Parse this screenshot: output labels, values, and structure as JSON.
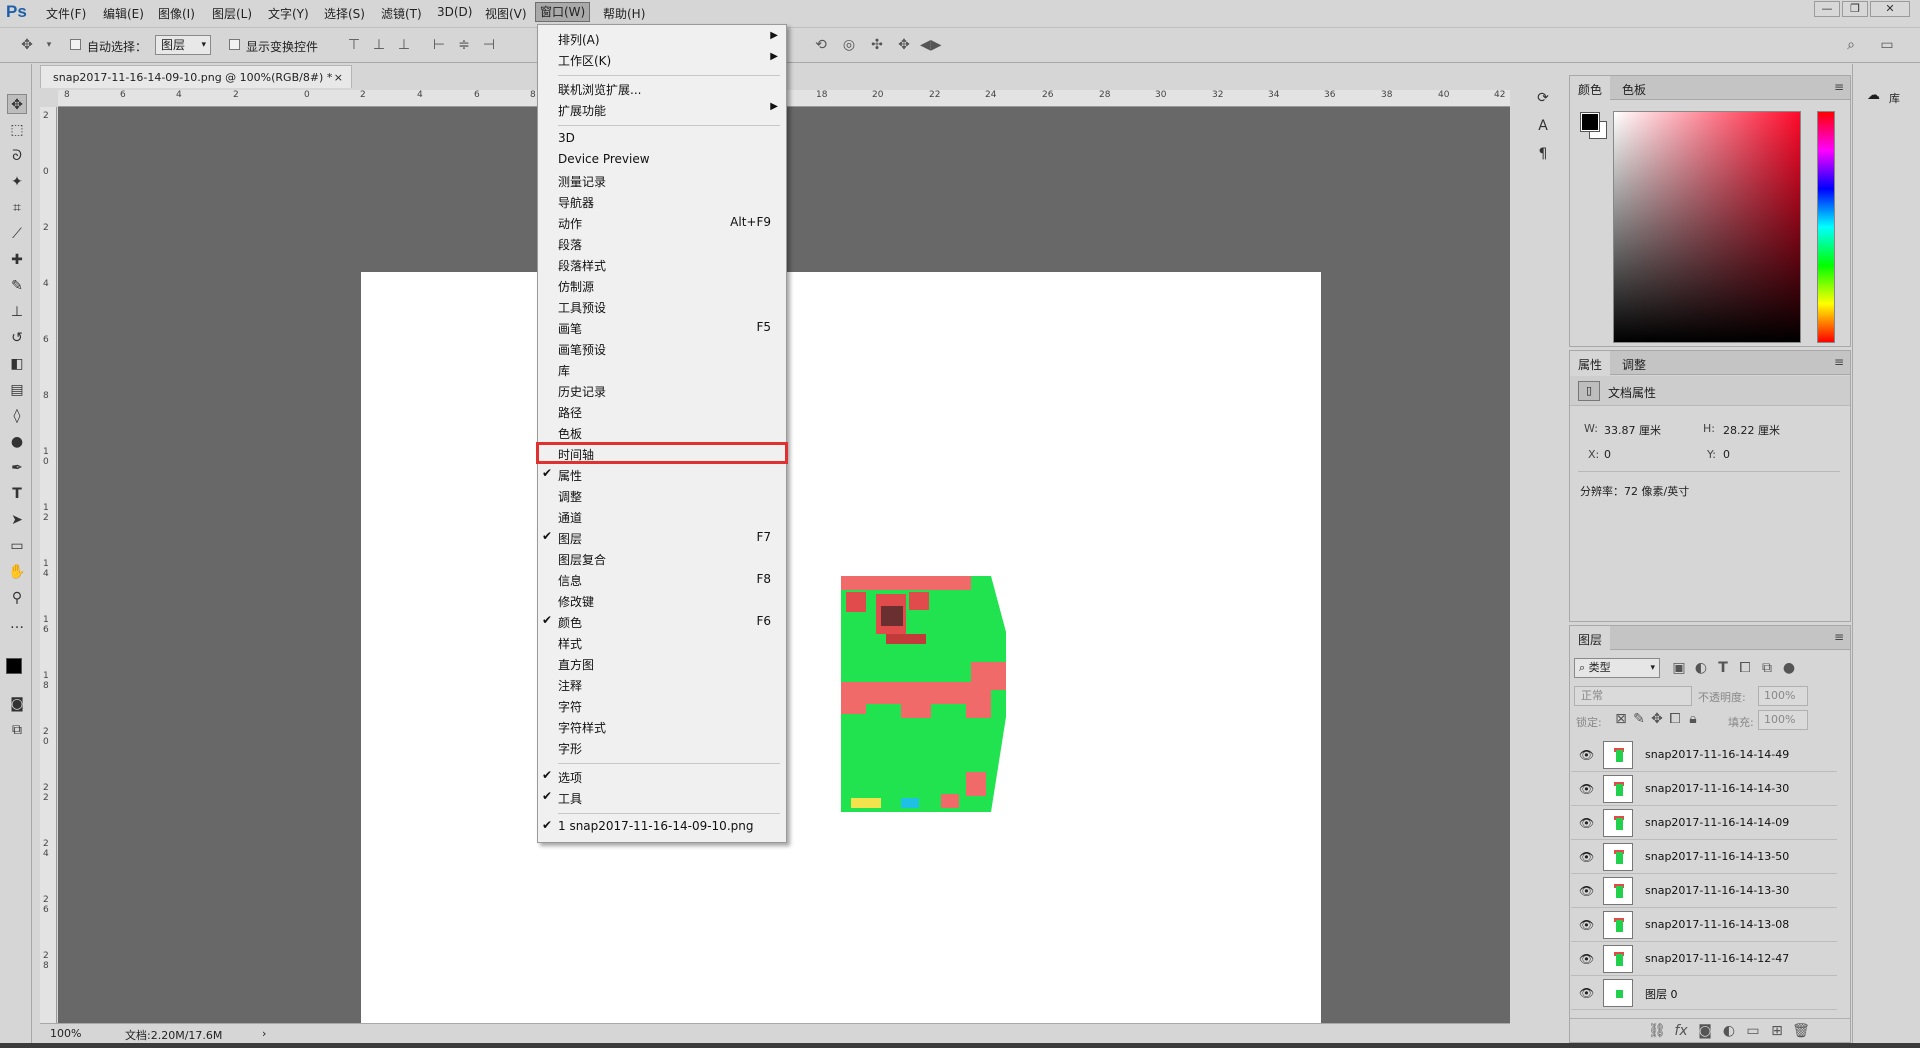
{
  "app": {
    "logo": "Ps",
    "menus": [
      "文件(F)",
      "编辑(E)",
      "图像(I)",
      "图层(L)",
      "文字(Y)",
      "选择(S)",
      "滤镜(T)",
      "3D(D)",
      "视图(V)",
      "窗口(W)",
      "帮助(H)"
    ],
    "active_menu": "窗口(W)",
    "window_buttons": [
      "—",
      "❐",
      "✕"
    ]
  },
  "options": {
    "auto_select_label": "自动选择：",
    "auto_select_value": "图层",
    "show_transform_label": "显示变换控件"
  },
  "document": {
    "tab_title": "snap2017-11-16-14-09-10.png @ 100%(RGB/8#) *",
    "tab_close": "×",
    "zoom": "100%",
    "doc_info": "文档:2.20M/17.6M",
    "ruler_h": [
      "8",
      "6",
      "4",
      "2",
      "0",
      "2",
      "4",
      "6",
      "8",
      "18",
      "20",
      "22",
      "24",
      "26",
      "28",
      "30",
      "32",
      "34",
      "36",
      "38",
      "40",
      "42"
    ],
    "ruler_v": [
      "2",
      "0",
      "2",
      "4",
      "6",
      "8",
      "1 0",
      "1 2",
      "1 4",
      "1 6",
      "1 8",
      "2 0",
      "2 2",
      "2 4",
      "2 6",
      "2 8"
    ]
  },
  "window_menu": {
    "items": [
      {
        "label": "排列(A)",
        "submenu": true
      },
      {
        "label": "工作区(K)",
        "submenu": true
      },
      {
        "sep": true
      },
      {
        "label": "联机浏览扩展..."
      },
      {
        "label": "扩展功能",
        "submenu": true
      },
      {
        "sep": true
      },
      {
        "label": "3D"
      },
      {
        "label": "Device Preview"
      },
      {
        "label": "测量记录"
      },
      {
        "label": "导航器"
      },
      {
        "label": "动作",
        "shortcut": "Alt+F9"
      },
      {
        "label": "段落"
      },
      {
        "label": "段落样式"
      },
      {
        "label": "仿制源"
      },
      {
        "label": "工具预设"
      },
      {
        "label": "画笔",
        "shortcut": "F5"
      },
      {
        "label": "画笔预设"
      },
      {
        "label": "库"
      },
      {
        "label": "历史记录"
      },
      {
        "label": "路径"
      },
      {
        "label": "色板"
      },
      {
        "label": "时间轴",
        "highlight": true
      },
      {
        "label": "属性",
        "checked": true
      },
      {
        "label": "调整"
      },
      {
        "label": "通道"
      },
      {
        "label": "图层",
        "checked": true,
        "shortcut": "F7"
      },
      {
        "label": "图层复合"
      },
      {
        "label": "信息",
        "shortcut": "F8"
      },
      {
        "label": "修改键"
      },
      {
        "label": "颜色",
        "checked": true,
        "shortcut": "F6"
      },
      {
        "label": "样式"
      },
      {
        "label": "直方图"
      },
      {
        "label": "注释"
      },
      {
        "label": "字符"
      },
      {
        "label": "字符样式"
      },
      {
        "label": "字形"
      },
      {
        "sep": true
      },
      {
        "label": "选项",
        "checked": true
      },
      {
        "label": "工具",
        "checked": true
      },
      {
        "sep": true
      },
      {
        "label": "1 snap2017-11-16-14-09-10.png",
        "checked": true
      }
    ],
    "highlight_color": "#e03131"
  },
  "color_panel": {
    "tabs": [
      "颜色",
      "色板"
    ],
    "foreground": "#000000",
    "background": "#ffffff"
  },
  "properties_panel": {
    "tabs": [
      "属性",
      "调整"
    ],
    "header": "文档属性",
    "w_label": "W:",
    "w_value": "33.87 厘米",
    "h_label": "H:",
    "h_value": "28.22 厘米",
    "x_label": "X:",
    "x_value": "0",
    "y_label": "Y:",
    "y_value": "0",
    "resolution": "分辨率：72 像素/英寸"
  },
  "layers_panel": {
    "tab": "图层",
    "filter": "类型",
    "blend_mode": "正常",
    "opacity_label": "不透明度:",
    "opacity_value": "100%",
    "lock_label": "锁定:",
    "fill_label": "填充:",
    "fill_value": "100%",
    "layers": [
      "snap2017-11-16-14-14-49",
      "snap2017-11-16-14-14-30",
      "snap2017-11-16-14-14-09",
      "snap2017-11-16-14-13-50",
      "snap2017-11-16-14-13-30",
      "snap2017-11-16-14-13-08",
      "snap2017-11-16-14-12-47",
      "图层 0"
    ]
  },
  "right_strip": {
    "library_label": "库"
  },
  "icons": {
    "tools": [
      "move-icon",
      "marquee-icon",
      "lasso-icon",
      "magic-wand-icon",
      "crop-icon",
      "eyedropper-icon",
      "healing-icon",
      "brush-icon",
      "stamp-icon",
      "history-brush-icon",
      "eraser-icon",
      "gradient-icon",
      "blur-icon",
      "dodge-icon",
      "pen-icon",
      "type-icon",
      "path-select-icon",
      "rectangle-icon",
      "hand-icon",
      "zoom-icon",
      "more-tools-icon"
    ]
  }
}
